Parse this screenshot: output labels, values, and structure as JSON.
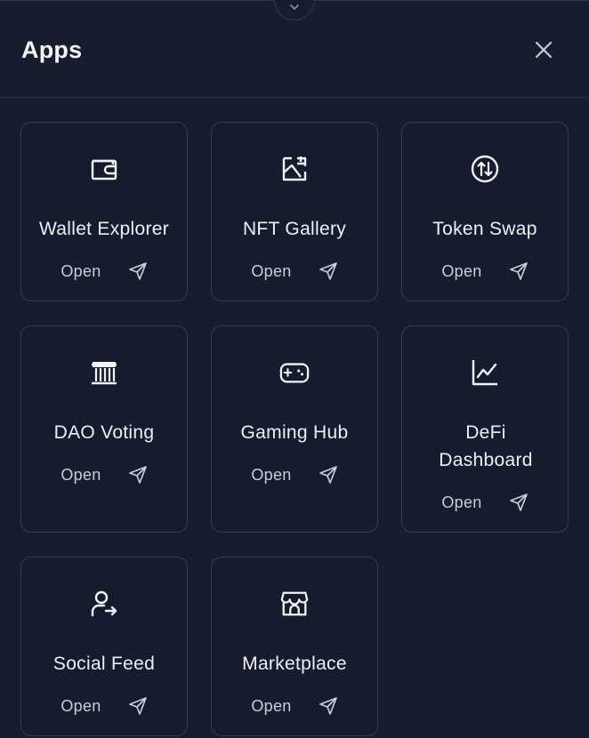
{
  "header": {
    "title": "Apps"
  },
  "apps": [
    {
      "name": "Wallet Explorer",
      "open_label": "Open",
      "icon": "wallet-icon"
    },
    {
      "name": "NFT Gallery",
      "open_label": "Open",
      "icon": "gallery-icon"
    },
    {
      "name": "Token Swap",
      "open_label": "Open",
      "icon": "swap-icon"
    },
    {
      "name": "DAO Voting",
      "open_label": "Open",
      "icon": "bank-icon"
    },
    {
      "name": "Gaming Hub",
      "open_label": "Open",
      "icon": "gamepad-icon"
    },
    {
      "name": "DeFi Dashboard",
      "open_label": "Open",
      "icon": "chart-line-icon"
    },
    {
      "name": "Social Feed",
      "open_label": "Open",
      "icon": "user-share-icon"
    },
    {
      "name": "Marketplace",
      "open_label": "Open",
      "icon": "store-icon"
    }
  ],
  "colors": {
    "background": "#171d2e",
    "card_border": "#323b53",
    "text": "#eef0f5"
  }
}
